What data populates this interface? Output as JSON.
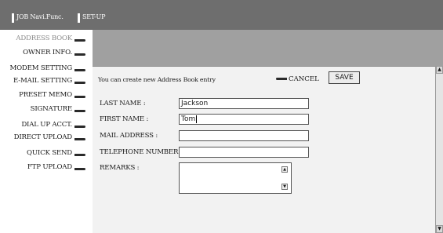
{
  "tabs": [
    {
      "label": "JOB Navi.Func."
    },
    {
      "label": "SET-UP"
    }
  ],
  "sidebar": {
    "items": [
      {
        "label": "ADDRESS BOOK",
        "active": true
      },
      {
        "label": "OWNER INFO.",
        "active": false
      },
      {
        "label": "MODEM SETTING",
        "active": false
      },
      {
        "label": "E-MAIL SETTING",
        "active": false
      },
      {
        "label": "PRESET MEMO",
        "active": false
      },
      {
        "label": "SIGNATURE",
        "active": false
      },
      {
        "label": "DIAL UP ACCT.",
        "active": false
      },
      {
        "label": "DIRECT UPLOAD",
        "active": false
      },
      {
        "label": "QUICK SEND",
        "active": false
      },
      {
        "label": "FTP UPLOAD",
        "active": false
      }
    ]
  },
  "main": {
    "message": "You can create new Address Book entry",
    "cancel_label": "CANCEL",
    "save_label": "SAVE",
    "form": {
      "last_name": {
        "label": "LAST NAME :",
        "value": "Jackson"
      },
      "first_name": {
        "label": "FIRST NAME :",
        "value": "Tom"
      },
      "mail_address": {
        "label": "MAIL ADDRESS :",
        "value": ""
      },
      "telephone": {
        "label": "TELEPHONE NUMBER",
        "value": ""
      },
      "remarks": {
        "label": "REMARKS :",
        "value": ""
      }
    }
  },
  "icons": {
    "sidebar_arrow": "arrow-right-icon",
    "cancel": "arrow-left-icon",
    "scroll_up": "scroll-up-icon",
    "scroll_down": "scroll-down-icon"
  }
}
